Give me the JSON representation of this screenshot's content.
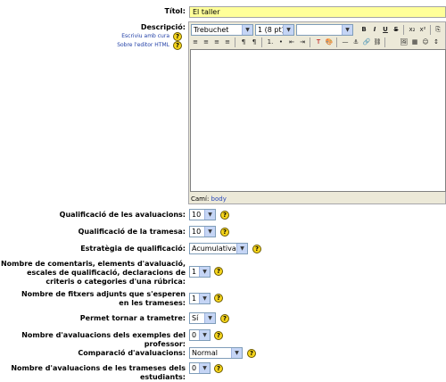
{
  "title_field": {
    "label": "Títol:",
    "value": "El taller"
  },
  "description": {
    "label": "Descripció:",
    "link_write_care": "Escriviu amb cura",
    "link_html_editor": "Sobre l'editor HTML",
    "font_family": "Trebuchet",
    "font_size": "1 (8 pt)",
    "paragraph": "",
    "path_label": "Camí:",
    "path_value": "body"
  },
  "toolbar_row1": [
    "B",
    "I",
    "U",
    "S",
    "x₂",
    "x²",
    "⎘",
    "✂"
  ],
  "toolbar_row2": [
    "≡",
    "≡",
    "≡",
    "≡",
    "¶",
    "¶",
    "1.",
    "•",
    "⇤",
    "⇥",
    "T",
    "🎨",
    "—",
    "⚓",
    "🔗",
    "⛓",
    "🖼",
    "▦",
    "☺",
    "↕"
  ],
  "fields": [
    {
      "label": "Qualificació de les avaluacions:",
      "value": "10"
    },
    {
      "label": "Qualificació de la tramesa:",
      "value": "10"
    },
    {
      "label": "Estratègia de qualificació:",
      "value": "Acumulativa"
    },
    {
      "label": "Nombre de comentaris, elements d'avaluació, escales de qualificació, declaracions de criteris o categories d'una rúbrica:",
      "value": "1"
    },
    {
      "label": "Nombre de fitxers adjunts que s'esperen en les trameses:",
      "value": "1"
    },
    {
      "label": "Permet tornar a trametre:",
      "value": "Sí"
    },
    {
      "label": "Nombre d'avaluacions dels exemples del professor:",
      "value": "0"
    },
    {
      "label": "Comparació d'avaluacions:",
      "value": "Normal"
    },
    {
      "label": "Nombre d'avaluacions de les trameses dels estudiants:",
      "value": "0"
    }
  ],
  "help_glyph": "?"
}
